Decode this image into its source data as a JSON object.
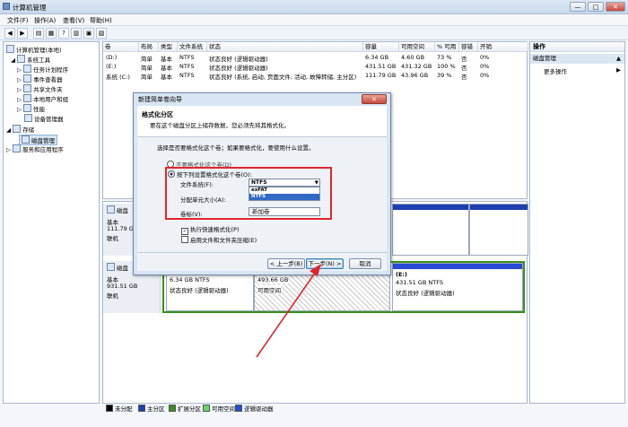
{
  "window": {
    "title": "计算机管理",
    "min": "—",
    "max": "□",
    "close": "✕"
  },
  "menu": [
    "文件(F)",
    "操作(A)",
    "查看(V)",
    "帮助(H)"
  ],
  "tree": {
    "root": "计算机管理(本地)",
    "system_tools": "系统工具",
    "task_scheduler": "任务计划程序",
    "event_viewer": "事件查看器",
    "shared_folders": "共享文件夹",
    "local_users": "本地用户和组",
    "performance": "性能",
    "device_manager": "设备管理器",
    "storage": "存储",
    "disk_management": "磁盘管理",
    "services": "服务和应用程序"
  },
  "volume_table": {
    "headers": [
      "卷",
      "布局",
      "类型",
      "文件系统",
      "状态",
      "容量",
      "可用空间",
      "% 可用",
      "容错",
      "开销"
    ],
    "rows": [
      [
        "(D:)",
        "简单",
        "基本",
        "NTFS",
        "状态良好 (逻辑驱动器)",
        "6.34 GB",
        "4.60 GB",
        "73 %",
        "否",
        "0%"
      ],
      [
        "(E:)",
        "简单",
        "基本",
        "NTFS",
        "状态良好 (逻辑驱动器)",
        "431.51 GB",
        "431.32 GB",
        "100 %",
        "否",
        "0%"
      ],
      [
        "系统 (C:)",
        "简单",
        "基本",
        "NTFS",
        "状态良好 (系统, 启动, 页面文件, 活动, 故障转储, 主分区)",
        "111.79 GB",
        "43.96 GB",
        "39 %",
        "否",
        "0%"
      ]
    ]
  },
  "disk0": {
    "name": "磁盘",
    "type": "基本",
    "size": "111.79 GB",
    "status": "联机"
  },
  "disk1": {
    "name": "磁盘",
    "type": "基本",
    "size": "931.51 GB",
    "status": "联机",
    "p1_line1": "6.34 GB NTFS",
    "p1_line2": "状态良好 (逻辑驱动器)",
    "p2_line1": "493.66 GB",
    "p2_line2": "可用空间",
    "p3_title": "(E:)",
    "p3_line1": "431.51 GB NTFS",
    "p3_line2": "状态良好 (逻辑驱动器)"
  },
  "actions": {
    "header": "操作",
    "section": "磁盘管理",
    "more": "更多操作",
    "arrow_up": "▲",
    "arrow_right": "▶"
  },
  "legend": [
    "未分配",
    "主分区",
    "扩展分区",
    "可用空间",
    "逻辑驱动器"
  ],
  "colors": {
    "unallocated": "#000000",
    "primary": "#1f3fb0",
    "extended": "#3a8f1f",
    "free": "#69d66a",
    "logical": "#2a48d8",
    "highlight": "#e0262c",
    "selection": "#316ac5"
  },
  "wizard": {
    "title": "新建简单卷向导",
    "close": "✕",
    "heading": "格式化分区",
    "subheading": "要在这个磁盘分区上储存数据，您必须先将其格式化。",
    "prompt": "选择是否要格式化这个卷；如果要格式化，要使用什么设置。",
    "opt_no": "不要格式化这个卷(D)",
    "opt_yes": "按下列设置格式化这个卷(O):",
    "fs_label": "文件系统(F):",
    "fs_value": "NTFS",
    "fs_options": [
      "exFAT",
      "NTFS"
    ],
    "alloc_label": "分配单元大小(A):",
    "vol_label": "卷标(V):",
    "vol_value": "新加卷",
    "quick_format": "执行快速格式化(P)",
    "compression": "启用文件和文件夹压缩(E)",
    "back": "< 上一步(B)",
    "next": "下一步(N) >",
    "cancel": "取消"
  }
}
